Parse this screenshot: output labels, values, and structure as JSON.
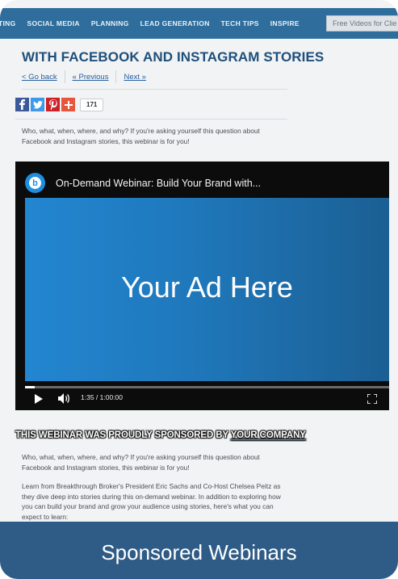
{
  "nav": {
    "items": [
      "TING",
      "SOCIAL MEDIA",
      "PLANNING",
      "LEAD GENERATION",
      "TECH TIPS",
      "INSPIRE"
    ],
    "free_videos": "Free Videos for Clie"
  },
  "article": {
    "headline": "WITH FACEBOOK AND INSTAGRAM STORIES",
    "go_back": "< Go back",
    "previous": "« Previous",
    "next": "Next »",
    "share_count": "171",
    "intro": "Who, what, when, where, and why? If you're asking yourself this question about Facebook and Instagram stories, this webinar is for you!"
  },
  "video": {
    "title": "On-Demand Webinar: Build Your Brand with...",
    "logo_letter": "b",
    "ad_text": "Your Ad Here",
    "time": "1:35 / 1:00:00",
    "progress_fraction": 0.026
  },
  "sponsor": {
    "prefix": "THIS WEBINAR WAS PROUDLY SPONSORED BY ",
    "company": "YOUR COMPANY"
  },
  "body": {
    "paragraph1": "Who, what, when, where, and why? If you're asking yourself this question about Facebook and Instagram stories, this webinar is for you!",
    "paragraph2": "Learn from Breakthrough Broker's President Eric Sachs and Co-Host Chelsea Peitz as they dive deep into stories during this on-demand webinar. In addition to exploring how you can build your brand and grow your audience using stories, here's what you can expect to learn:"
  },
  "banner": {
    "text": "Sponsored Webinars"
  },
  "colors": {
    "nav": "#2f6e9c",
    "headline": "#1e4f7a",
    "banner": "#2f5c86",
    "ad_start": "#2386d1",
    "ad_end": "#1b5f93"
  },
  "icons": {
    "share": [
      "facebook-icon",
      "twitter-icon",
      "pinterest-icon",
      "plus-icon"
    ],
    "player": [
      "play-icon",
      "volume-icon",
      "fullscreen-icon"
    ]
  }
}
